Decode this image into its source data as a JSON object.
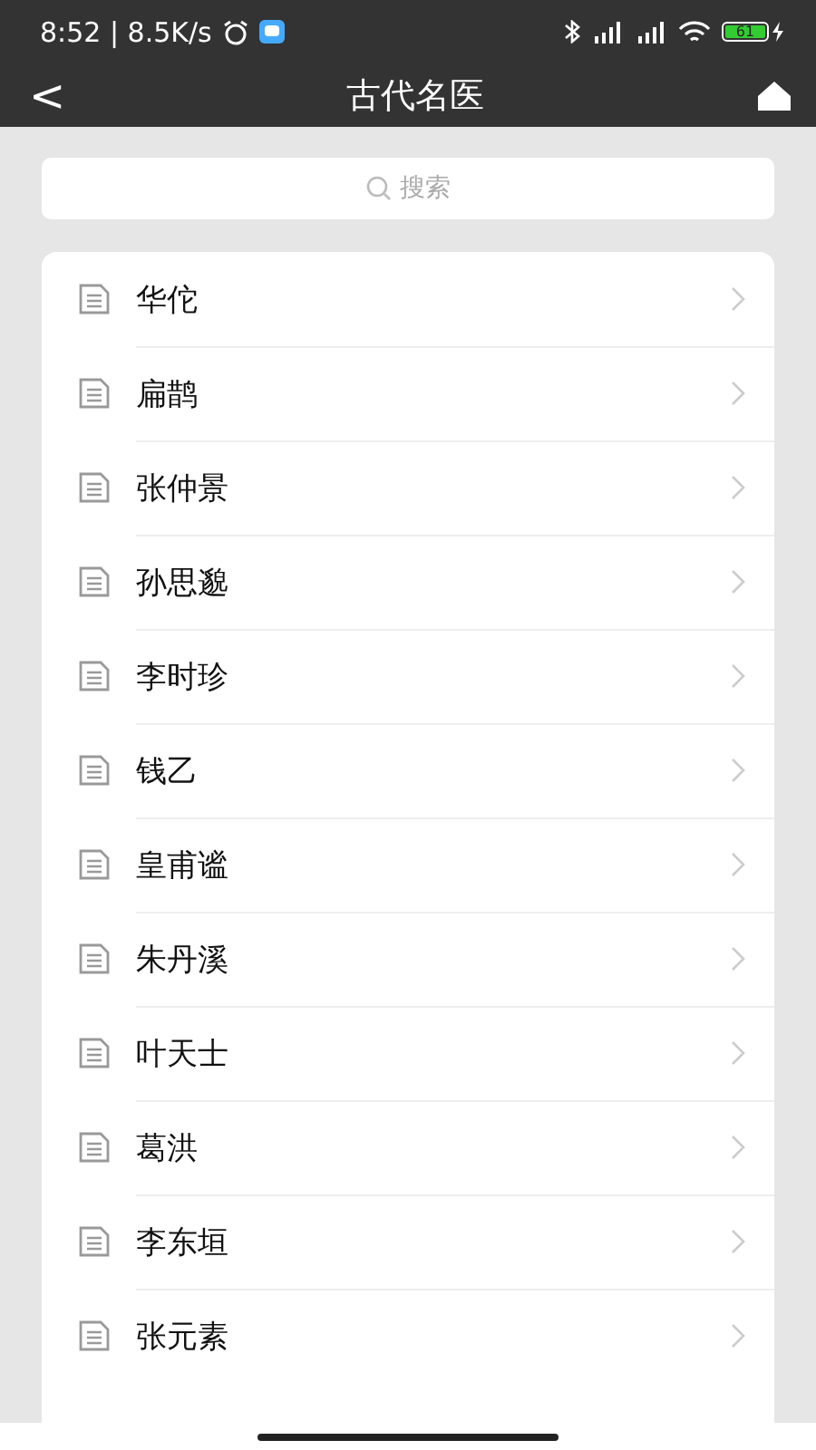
{
  "status_bar": {
    "time": "8:52 | 8.5K/s",
    "battery": "61"
  },
  "header": {
    "back": "<",
    "title": "古代名医"
  },
  "search": {
    "placeholder": "搜索"
  },
  "list": {
    "items": [
      {
        "name": "华佗"
      },
      {
        "name": "扁鹊"
      },
      {
        "name": "张仲景"
      },
      {
        "name": "孙思邈"
      },
      {
        "name": "李时珍"
      },
      {
        "name": "钱乙"
      },
      {
        "name": "皇甫谧"
      },
      {
        "name": "朱丹溪"
      },
      {
        "name": "叶天士"
      },
      {
        "name": "葛洪"
      },
      {
        "name": "李东垣"
      },
      {
        "name": "张元素"
      }
    ]
  }
}
